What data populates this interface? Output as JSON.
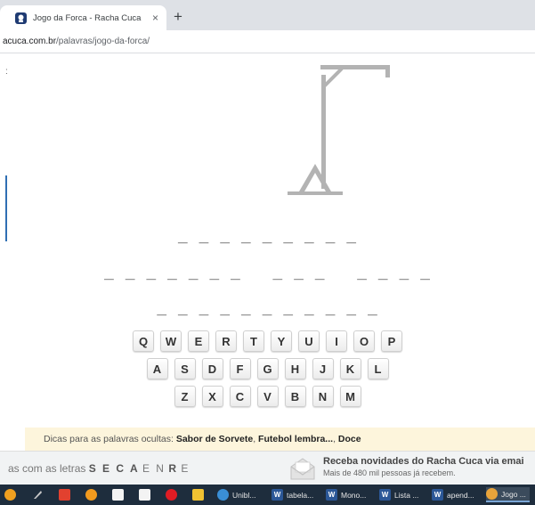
{
  "browser": {
    "tab_title": "Jogo da Forca - Racha Cuca",
    "tab_close": "×",
    "new_tab": "+",
    "url_host": "acuca.com.br",
    "url_path": "/palavras/jogo-da-forca/"
  },
  "page": {
    "side_text": ":",
    "words": [
      "_ _ _ _ _ _ _ _ _",
      "_ _ _ _ _ _ _   _ _ _   _ _ _ _",
      "_ _ _ _ _ _ _ _ _ _ _"
    ],
    "keyboard": [
      [
        "Q",
        "W",
        "E",
        "R",
        "T",
        "Y",
        "U",
        "I",
        "O",
        "P"
      ],
      [
        "A",
        "S",
        "D",
        "F",
        "G",
        "H",
        "J",
        "K",
        "L"
      ],
      [
        "Z",
        "X",
        "C",
        "V",
        "B",
        "N",
        "M"
      ]
    ],
    "hints": {
      "prefix": "Dicas para as palavras ocultas:",
      "hint1": "Sabor de Sorvete",
      "hint2": "Futebol lembra...",
      "hint3": "Doce",
      "sep": ","
    }
  },
  "footer": {
    "used_prefix": "as com as letras",
    "used_strong": "S E C A",
    "used_light": "E N",
    "used_strong2": "R",
    "used_light2": "E",
    "newsletter_title": "Receba novidades do Racha Cuca via emai",
    "newsletter_sub": "Mais de 480 mil pessoas já recebem."
  },
  "taskbar": {
    "items": [
      {
        "label": "Unibl...",
        "icon": "chrome-like-icon"
      },
      {
        "label": "tabela...",
        "icon": "word-icon"
      },
      {
        "label": "Mono...",
        "icon": "word-icon"
      },
      {
        "label": "Lista ...",
        "icon": "word-icon"
      },
      {
        "label": "apend...",
        "icon": "word-icon"
      },
      {
        "label": "Jogo ...",
        "icon": "chrome-icon"
      }
    ],
    "word_glyph": "W"
  },
  "colors": {
    "accent": "#2f6fb3",
    "gallows": "#b3b3b3",
    "hint_bg": "#fdf5dc",
    "taskbar": "#1e2d3d"
  }
}
